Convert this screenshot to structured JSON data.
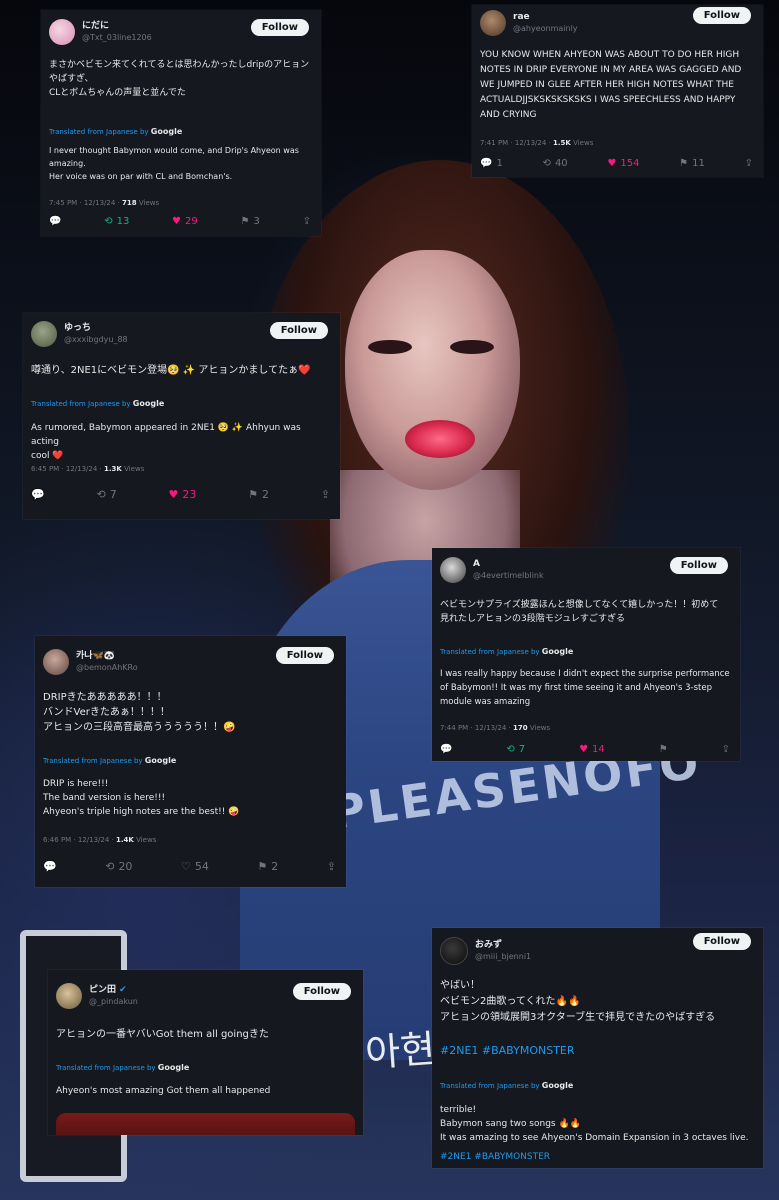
{
  "tweets": {
    "t1": {
      "name": "にだに",
      "handle": "@Txt_03line1206",
      "follow": "Follow",
      "text": "まさかベビモン来てくれてるとは思わんかったしdripのアヒョン\nやばすぎ、\nCLとボムちゃんの声量と並んでた",
      "translated_from": "Translated from Japanese by",
      "translator": "Google",
      "translation": "I never thought Babymon would come, and Drip's Ahyeon was\namazing.\nHer voice was on par with CL and Bomchan's.",
      "time": "7:45 PM · 12/13/24 ·",
      "views": "718",
      "views_label": "Views",
      "retweets": "13",
      "likes": "29",
      "bookmarks": "3"
    },
    "t2": {
      "name": "rae",
      "handle": "@ahyeonmainly",
      "follow": "Follow",
      "text": "YOU KNOW WHEN AHYEON WAS ABOUT TO DO HER HIGH NOTES IN DRIP EVERYONE IN MY AREA WAS GAGGED AND WE JUMPED IN GLEE AFTER HER HIGH NOTES WHAT THE ACTUALDJJSKSKSKSKSKS I WAS SPEECHLESS AND HAPPY AND CRYING",
      "time": "7:41 PM · 12/13/24 ·",
      "views": "1.5K",
      "views_label": "Views",
      "replies": "1",
      "retweets": "40",
      "likes": "154",
      "bookmarks": "11"
    },
    "t3": {
      "name": "ゆっち",
      "handle": "@xxxibgdyu_88",
      "follow": "Follow",
      "text": "噂通り、2NE1にベビモン登場🥺 ✨ アヒョンかましてたぁ❤️",
      "translated_from": "Translated from Japanese by",
      "translator": "Google",
      "translation": "As rumored, Babymon appeared in 2NE1 🥺 ✨ Ahhyun was acting\ncool ❤️",
      "time": "6:45 PM · 12/13/24 ·",
      "views": "1.3K",
      "views_label": "Views",
      "retweets": "7",
      "likes": "23",
      "bookmarks": "2"
    },
    "t4": {
      "name": "A",
      "handle": "@4evertimeIblink",
      "follow": "Follow",
      "text": "ベビモンサプライズ披露ほんと想像してなくて嬉しかった！！初めて\n見れたしアヒョンの3段階モジュレすごすぎる",
      "translated_from": "Translated from Japanese by",
      "translator": "Google",
      "translation": "I was really happy because I didn't expect the surprise performance of Babymon!! It was my first time seeing it and Ahyeon's 3-step module was amazing",
      "time": "7:44 PM · 12/13/24 ·",
      "views": "170",
      "views_label": "Views",
      "retweets": "7",
      "likes": "14"
    },
    "t5": {
      "name": "카나🦋🐼",
      "handle": "@bemonAhKRo",
      "follow": "Follow",
      "text": "DRIPきたあああああ！！！\nバンドVerきたあぁ！！！！\nアヒョンの三段高音最高ううううう！！🤪",
      "translated_from": "Translated from Japanese by",
      "translator": "Google",
      "translation": "DRIP is here!!!\nThe band version is here!!!\nAhyeon's triple high notes are the best!! 🤪",
      "time": "6:46 PM · 12/13/24 ·",
      "views": "1.4K",
      "views_label": "Views",
      "retweets": "20",
      "likes": "54",
      "bookmarks": "2"
    },
    "t6": {
      "name": "ピン田",
      "handle": "@_pindakun",
      "follow": "Follow",
      "text": "アヒョンの一番ヤバいGot them all goingきた",
      "translated_from": "Translated from Japanese by",
      "translator": "Google",
      "translation": "Ahyeon's most amazing Got them all happened"
    },
    "t7": {
      "name": "おみず",
      "handle": "@miii_bjenni1",
      "follow": "Follow",
      "text": "やばい！\nベビモン2曲歌ってくれた🔥🔥\nアヒョンの領域展開3オクターブ生で拝見できたのやばすぎる",
      "hashtags": "#2NE1 #BABYMONSTER",
      "translated_from": "Translated from Japanese by",
      "translator": "Google",
      "translation": "terrible!\nBabymon sang two songs 🔥🔥\nIt was amazing to see Ahyeon's Domain Expansion in 3 octaves live.",
      "hashtags_2": "#2NE1 #BABYMONSTER"
    }
  },
  "background": {
    "shirt_text": "PLEASENOFO",
    "doodle_text": "아현"
  },
  "colors": {
    "card_bg": "#15181f",
    "link_blue": "#1d9bf0",
    "like_pink": "#f91880",
    "retweet_green": "#00ba7c",
    "muted": "#71767b"
  }
}
